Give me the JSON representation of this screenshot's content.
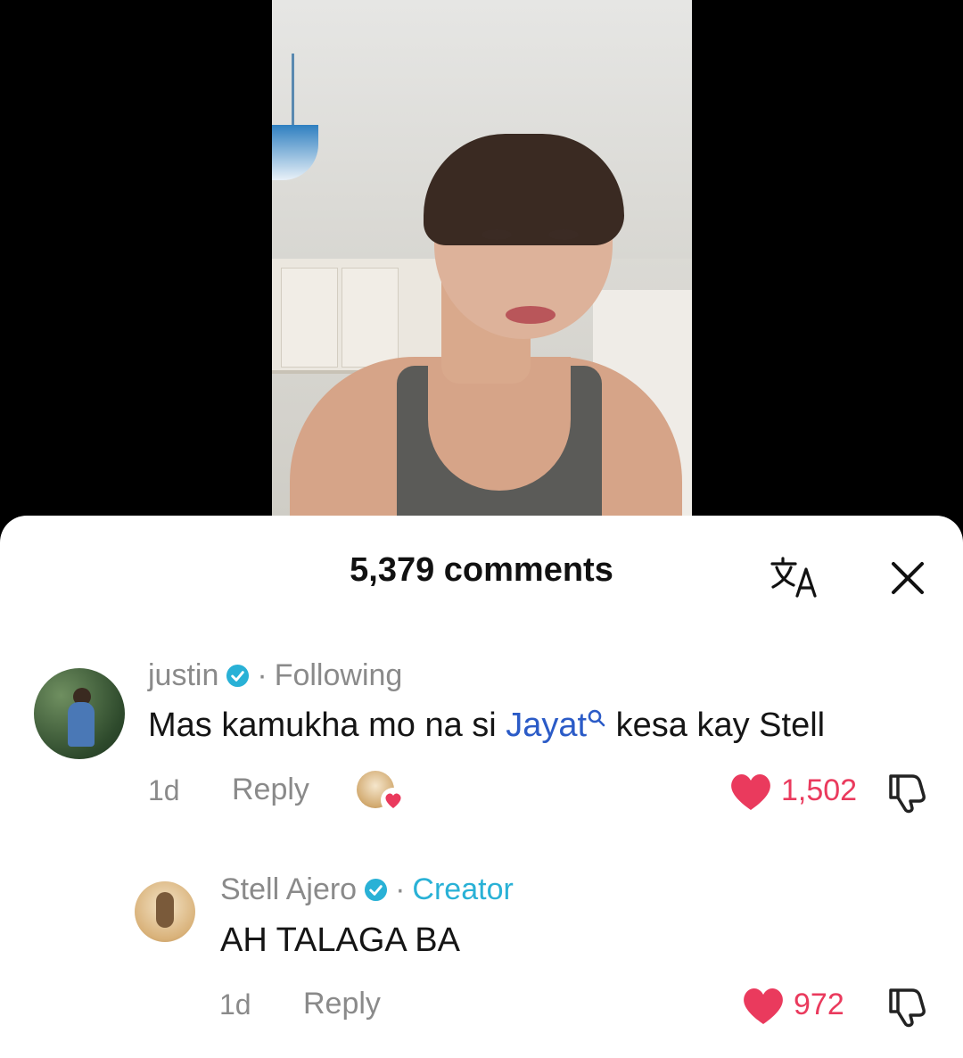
{
  "sheet": {
    "title": "5,379 comments",
    "translate_icon": "translate-icon",
    "close_icon": "close-icon"
  },
  "comments": [
    {
      "username": "justin",
      "verified": true,
      "separator": "·",
      "relation": "Following",
      "text_before": "Mas kamukha mo na si ",
      "mention": "Jayat",
      "text_after": " kesa kay Stell",
      "time": "1d",
      "reply_label": "Reply",
      "creator_liked": true,
      "likes": "1,502",
      "liked": true
    },
    {
      "username": "Stell Ajero",
      "verified": true,
      "separator": "·",
      "relation": "Creator",
      "text": "AH TALAGA BA",
      "time": "1d",
      "reply_label": "Reply",
      "likes": "972",
      "liked": true
    }
  ],
  "colors": {
    "like_red": "#ea3a5d",
    "verified_blue": "#29b1d6",
    "mention_blue": "#2b5bc7",
    "muted_text": "#8a8a8a"
  }
}
